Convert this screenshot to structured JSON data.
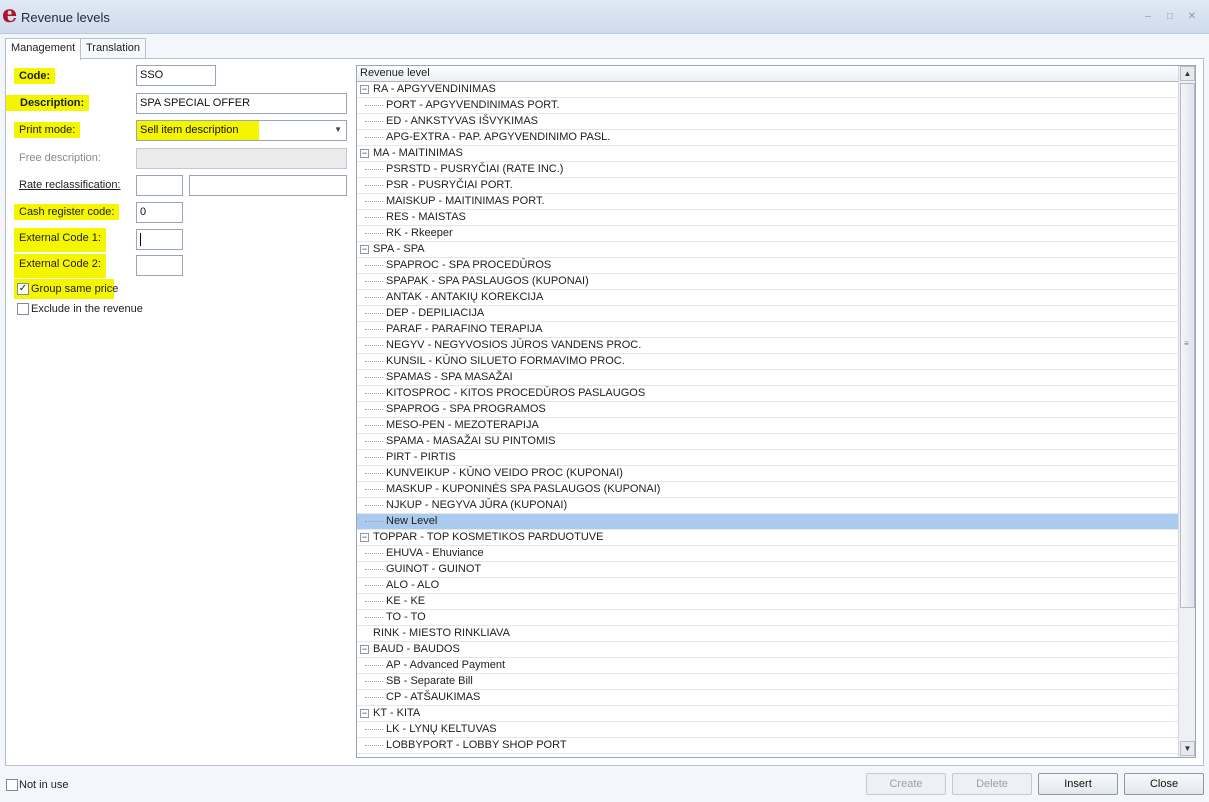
{
  "window": {
    "title": "Revenue levels",
    "logo": "e"
  },
  "tabs": [
    {
      "label": "Management",
      "active": true
    },
    {
      "label": "Translation",
      "active": false
    }
  ],
  "form": {
    "code_label": "Code:",
    "code_value": "SSO",
    "description_label": "Description:",
    "description_value": "SPA SPECIAL OFFER",
    "print_mode_label": "Print mode:",
    "print_mode_value": "Sell item description",
    "free_description_label": "Free description:",
    "free_description_value": "",
    "rate_reclass_label": "Rate reclassification:",
    "rate_reclass_code": "",
    "rate_reclass_name": "",
    "cash_register_label": "Cash register code:",
    "cash_register_value": "0",
    "ext_code1_label": "External Code 1:",
    "ext_code1_value": "",
    "ext_code2_label": "External Code 2:",
    "ext_code2_value": "",
    "group_same_price_label": "Group same price",
    "group_same_price_checked": true,
    "exclude_revenue_label": "Exclude in the revenue",
    "exclude_revenue_checked": false
  },
  "tree": {
    "header": "Revenue level",
    "rows": [
      {
        "text": "RA - APGYVENDINIMAS",
        "type": "group"
      },
      {
        "text": "PORT - APGYVENDINIMAS PORT.",
        "type": "child"
      },
      {
        "text": "ED - ANKSTYVAS IŠVYKIMAS",
        "type": "child"
      },
      {
        "text": "APG-EXTRA - PAP. APGYVENDINIMO PASL.",
        "type": "child"
      },
      {
        "text": "MA - MAITINIMAS",
        "type": "group"
      },
      {
        "text": "PSRSTD - PUSRYČIAI (RATE INC.)",
        "type": "child"
      },
      {
        "text": "PSR - PUSRYČIAI PORT.",
        "type": "child"
      },
      {
        "text": "MAISKUP - MAITINIMAS PORT.",
        "type": "child"
      },
      {
        "text": "RES - MAISTAS",
        "type": "child"
      },
      {
        "text": "RK - Rkeeper",
        "type": "child"
      },
      {
        "text": "SPA - SPA",
        "type": "group"
      },
      {
        "text": "SPAPROC - SPA PROCEDŪROS",
        "type": "child"
      },
      {
        "text": "SPAPAK - SPA PASLAUGOS (KUPONAI)",
        "type": "child"
      },
      {
        "text": "ANTAK - ANTAKIŲ KOREKCIJA",
        "type": "child"
      },
      {
        "text": "DEP - DEPILIACIJA",
        "type": "child"
      },
      {
        "text": "PARAF - PARAFINO TERAPIJA",
        "type": "child"
      },
      {
        "text": "NEGYV - NEGYVOSIOS JŪROS VANDENS PROC.",
        "type": "child"
      },
      {
        "text": "KUNSIL - KŪNO SILUETO FORMAVIMO PROC.",
        "type": "child"
      },
      {
        "text": "SPAMAS - SPA MASAŽAI",
        "type": "child"
      },
      {
        "text": "KITOSPROC - KITOS PROCEDŪROS PASLAUGOS",
        "type": "child"
      },
      {
        "text": "SPAPROG - SPA PROGRAMOS",
        "type": "child"
      },
      {
        "text": "MESO-PEN - MEZOTERAPIJA",
        "type": "child"
      },
      {
        "text": "SPAMA - MASAŽAI SU PINTOMIS",
        "type": "child"
      },
      {
        "text": "PIRT - PIRTIS",
        "type": "child"
      },
      {
        "text": "KUNVEIKUP - KŪNO VEIDO PROC (KUPONAI)",
        "type": "child"
      },
      {
        "text": "MASKUP - KUPONINĖS SPA PASLAUGOS (KUPONAI)",
        "type": "child"
      },
      {
        "text": "NJKUP - NEGYVA JŪRA (KUPONAI)",
        "type": "child"
      },
      {
        "text": "New Level",
        "type": "child",
        "selected": true
      },
      {
        "text": "TOPPAR - TOP KOSMETIKOS PARDUOTUVE",
        "type": "group"
      },
      {
        "text": "EHUVA - Ehuviance",
        "type": "child"
      },
      {
        "text": "GUINOT - GUINOT",
        "type": "child"
      },
      {
        "text": "ALO - ALO",
        "type": "child"
      },
      {
        "text": "KE - KE",
        "type": "child"
      },
      {
        "text": "TO - TO",
        "type": "child"
      },
      {
        "text": "RINK - MIESTO RINKLIAVA",
        "type": "leaf-top"
      },
      {
        "text": "BAUD - BAUDOS",
        "type": "group"
      },
      {
        "text": "AP - Advanced Payment",
        "type": "child"
      },
      {
        "text": "SB - Separate Bill",
        "type": "child"
      },
      {
        "text": "CP - ATŠAUKIMAS",
        "type": "child"
      },
      {
        "text": "KT - KITA",
        "type": "group"
      },
      {
        "text": "LK - LYNŲ KELTUVAS",
        "type": "child"
      },
      {
        "text": "LOBBYPORT - LOBBY SHOP PORT",
        "type": "child"
      }
    ]
  },
  "footer": {
    "not_in_use_label": "Not in use",
    "not_in_use_checked": false,
    "create_label": "Create",
    "delete_label": "Delete",
    "insert_label": "Insert",
    "close_label": "Close"
  },
  "colors": {
    "highlight": "#f5f500",
    "selection": "#aacbef",
    "logo": "#b0122b"
  },
  "icons": {
    "expander": "minus-box-icon",
    "scroll_up": "arrow-up-icon",
    "scroll_down": "arrow-down-icon"
  }
}
